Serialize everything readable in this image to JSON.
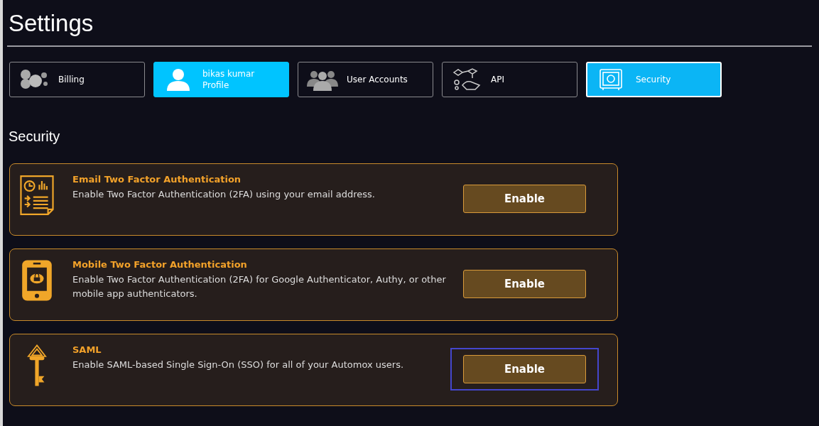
{
  "page": {
    "title": "Settings"
  },
  "tabs": [
    {
      "kind": "billing",
      "label": "Billing",
      "selected": false,
      "highlighted": false
    },
    {
      "kind": "profile",
      "label": "bikas kumar",
      "sublabel": "Profile",
      "selected": false,
      "highlighted": true
    },
    {
      "kind": "users",
      "label": "User Accounts",
      "selected": false,
      "highlighted": false
    },
    {
      "kind": "api",
      "label": "API",
      "selected": false,
      "highlighted": false
    },
    {
      "kind": "security",
      "label": "Security",
      "selected": true,
      "highlighted": true
    }
  ],
  "section": {
    "title": "Security"
  },
  "options": [
    {
      "kind": "document",
      "title": "Email Two Factor Authentication",
      "description": "Enable Two Factor Authentication (2FA) using your email address.",
      "button": "Enable",
      "focused": false
    },
    {
      "kind": "phone",
      "title": "Mobile Two Factor Authentication",
      "description": "Enable Two Factor Authentication (2FA) for Google Authenticator, Authy, or other mobile app authenticators.",
      "button": "Enable",
      "focused": false
    },
    {
      "kind": "key",
      "title": "SAML",
      "description": "Enable SAML-based Single Sign-On (SSO) for all of your Automox users.",
      "button": "Enable",
      "focused": true
    }
  ]
}
